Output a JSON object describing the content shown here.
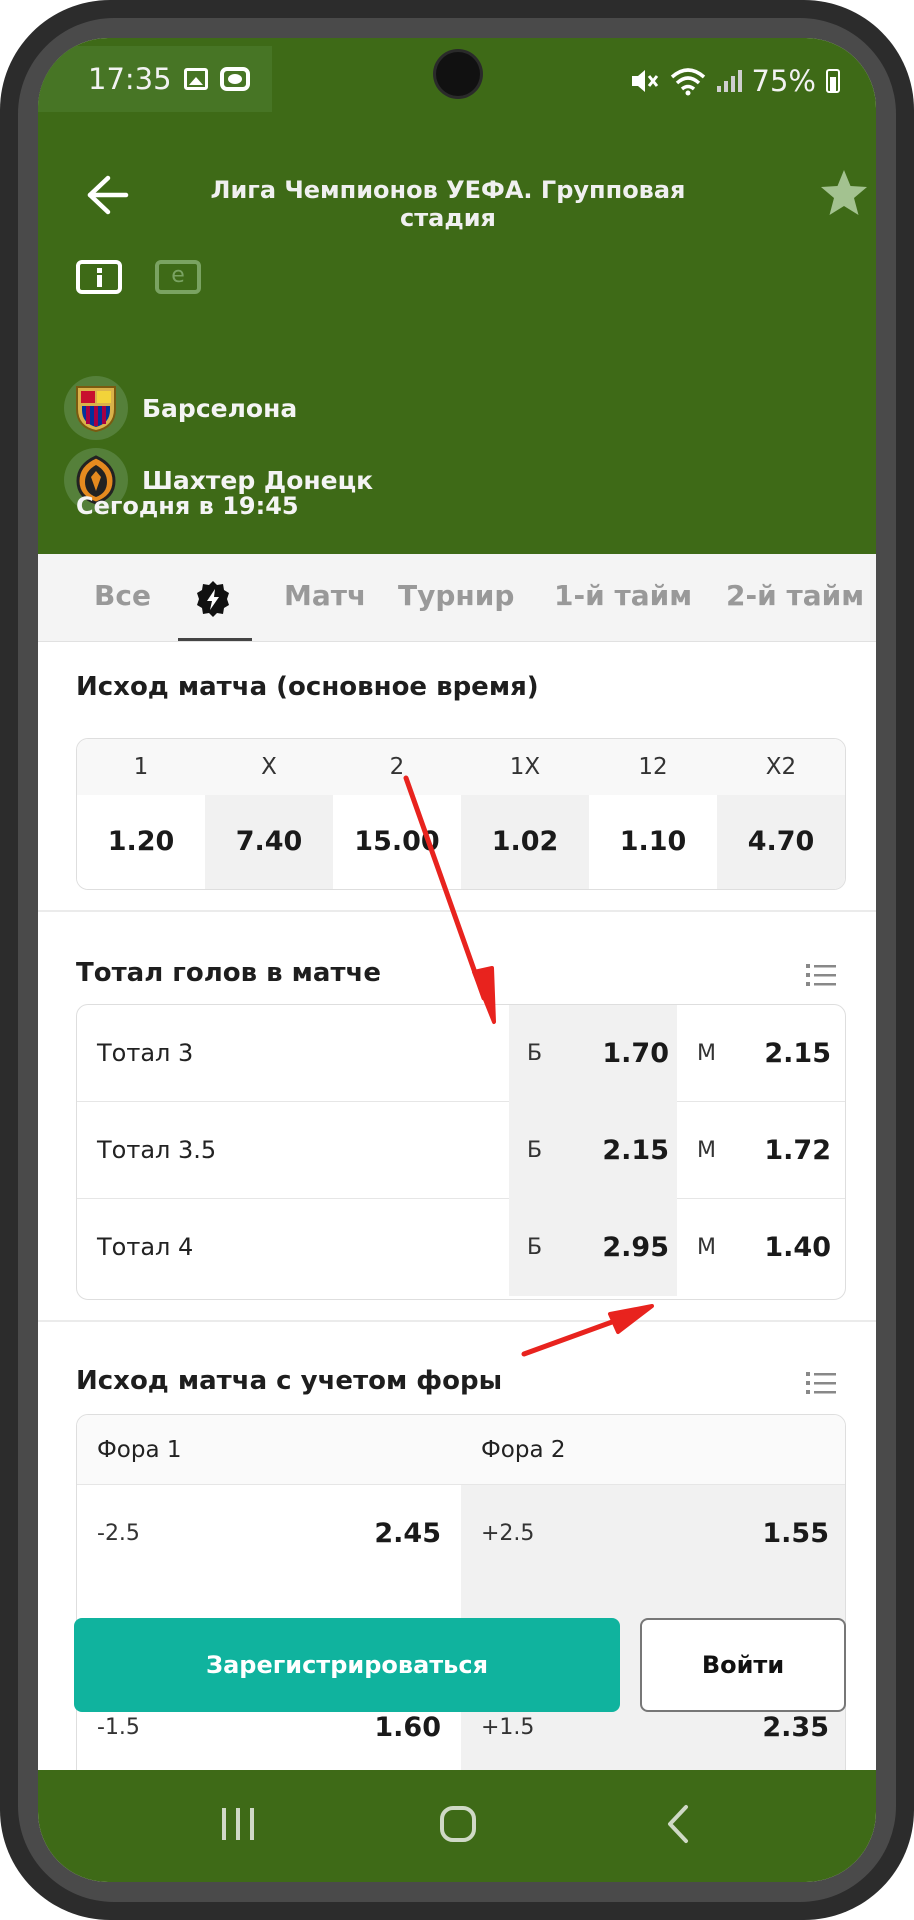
{
  "status_bar": {
    "time": "17:35",
    "battery": "75%"
  },
  "header": {
    "title": "Лига Чемпионов УЕФА. Групповая стадия",
    "stats_icon_letter": "e",
    "team1": "Барселона",
    "team2": "Шахтер Донецк",
    "match_time": "Сегодня в 19:45"
  },
  "tabs": [
    "Все",
    "Матч",
    "Турнир",
    "1-й тайм",
    "2-й тайм"
  ],
  "outcome": {
    "title": "Исход матча (основное время)",
    "headers": [
      "1",
      "X",
      "2",
      "1X",
      "12",
      "X2"
    ],
    "values": [
      "1.20",
      "7.40",
      "15.00",
      "1.02",
      "1.10",
      "4.70"
    ]
  },
  "totals": {
    "title": "Тотал голов в матче",
    "over_letter": "Б",
    "under_letter": "М",
    "rows": [
      {
        "label": "Тотал 3",
        "over": "1.70",
        "under": "2.15"
      },
      {
        "label": "Тотал 3.5",
        "over": "2.15",
        "under": "1.72"
      },
      {
        "label": "Тотал 4",
        "over": "2.95",
        "under": "1.40"
      }
    ]
  },
  "handicap": {
    "title": "Исход матча с учетом форы",
    "col1": "Фора 1",
    "col2": "Фора 2",
    "rows": [
      {
        "h1": "-2.5",
        "c1": "2.45",
        "h2": "+2.5",
        "c2": "1.55"
      },
      {
        "h1": "",
        "c1": "",
        "h2": "",
        "c2": ""
      },
      {
        "h1": "-1.5",
        "c1": "1.60",
        "h2": "+1.5",
        "c2": "2.35"
      }
    ]
  },
  "buttons": {
    "register": "Зарегистрироваться",
    "login": "Войти"
  },
  "colors": {
    "header_green": "#3e6a17",
    "register_teal": "#10b39e",
    "arrow_red": "#e8231e"
  },
  "icons": [
    "back-arrow-icon",
    "star-icon",
    "info-icon",
    "stats-icon",
    "bolt-icon",
    "list-icon",
    "recent-apps-icon",
    "home-icon",
    "back-nav-icon"
  ]
}
